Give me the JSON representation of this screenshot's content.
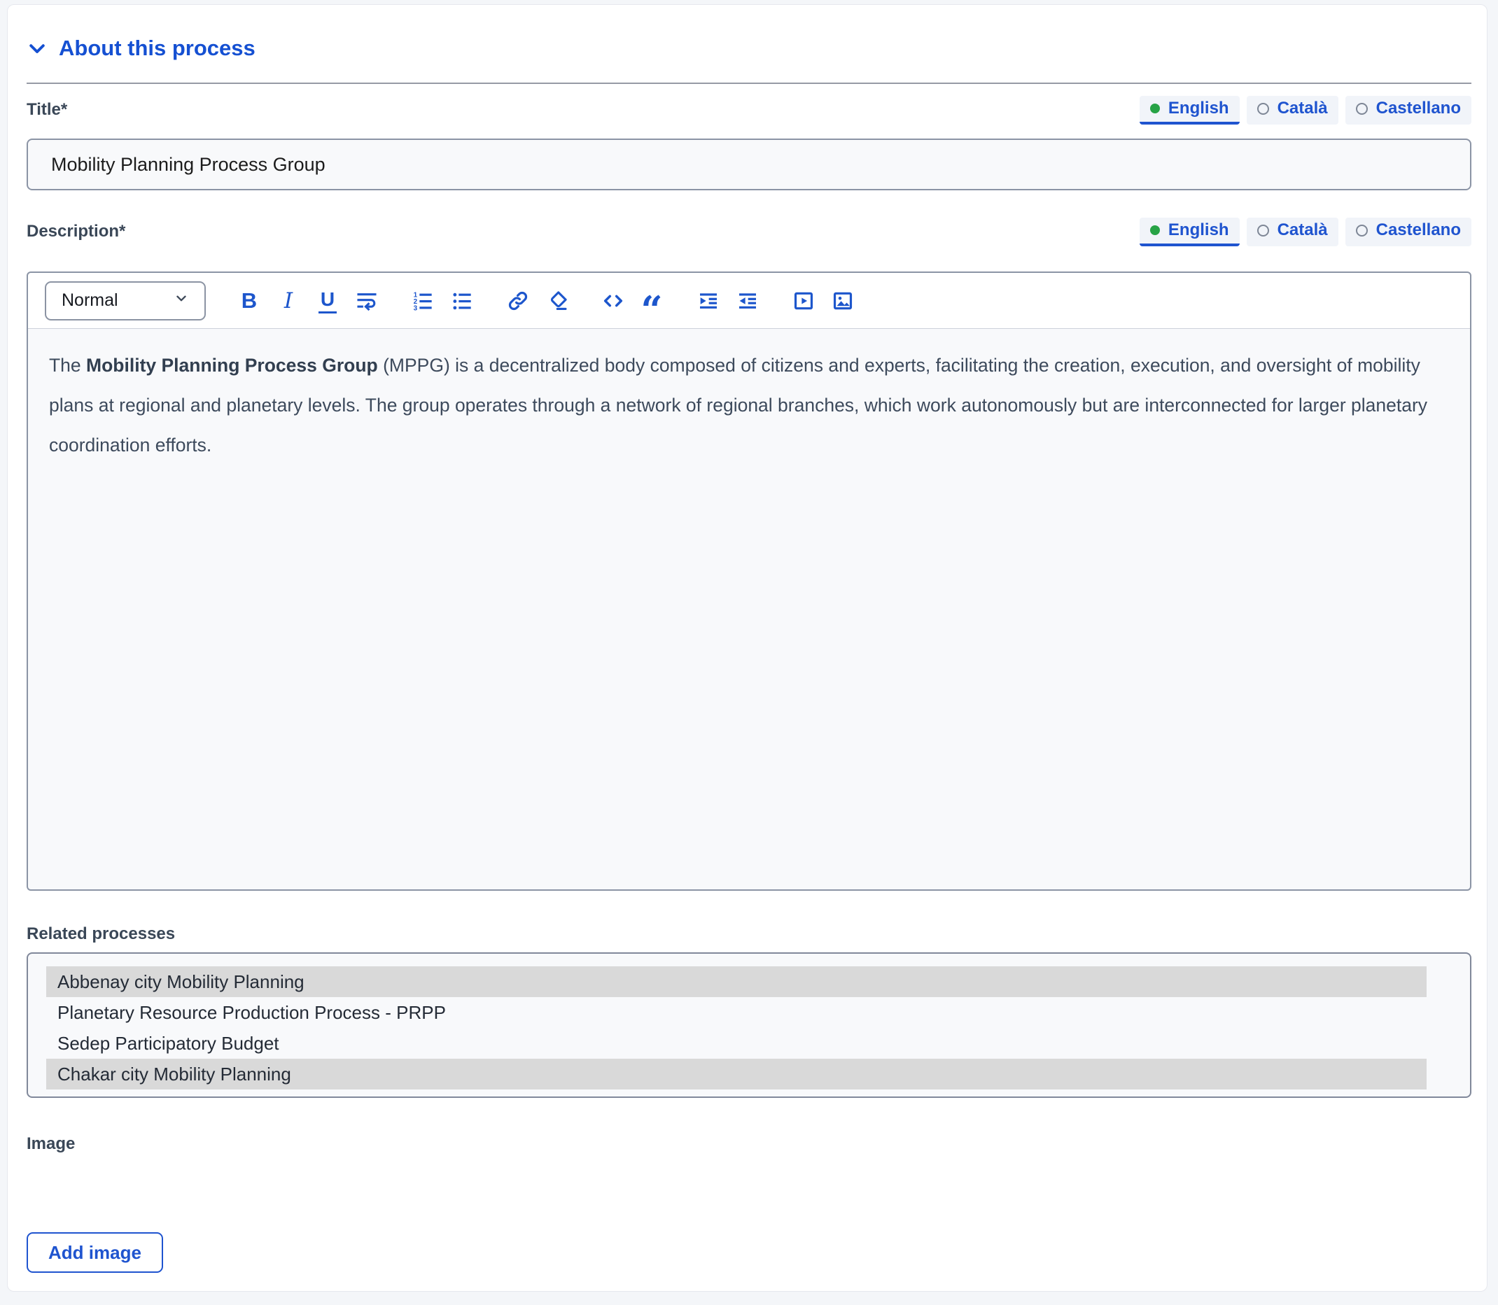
{
  "section": {
    "title": "About this process"
  },
  "colors": {
    "accent_blue": "#1d56cc",
    "heading_blue": "#1550d2",
    "selected_option_bg": "#d9d9d9",
    "active_language_dot": "#27a346"
  },
  "language_tabs": [
    {
      "label": "English",
      "selected": true
    },
    {
      "label": "Català",
      "selected": false
    },
    {
      "label": "Castellano",
      "selected": false
    }
  ],
  "title_field": {
    "label": "Title*",
    "value": "Mobility Planning Process Group"
  },
  "description_field": {
    "label": "Description*",
    "paragraph_style": "Normal",
    "toolbar_icons": [
      "bold",
      "italic",
      "underline",
      "line-break",
      "ordered-list",
      "bullet-list",
      "link",
      "clear-formatting",
      "code",
      "blockquote",
      "indent-increase",
      "indent-decrease",
      "video",
      "image"
    ],
    "content": {
      "prefix": "The ",
      "bold": "Mobility Planning Process Group",
      "rest": " (MPPG) is a decentralized body composed of citizens and experts, facilitating the creation, execution, and oversight of mobility plans at regional and planetary levels. The group operates through a network of regional branches, which work autonomously but are interconnected for larger planetary coordination efforts."
    }
  },
  "related_processes": {
    "label": "Related processes",
    "options": [
      {
        "label": "Abbenay city Mobility Planning",
        "selected": true
      },
      {
        "label": "Planetary Resource Production Process - PRPP",
        "selected": false
      },
      {
        "label": "Sedep Participatory Budget",
        "selected": false
      },
      {
        "label": "Chakar city Mobility Planning",
        "selected": true
      }
    ]
  },
  "image_section": {
    "label": "Image",
    "add_button": "Add image"
  }
}
